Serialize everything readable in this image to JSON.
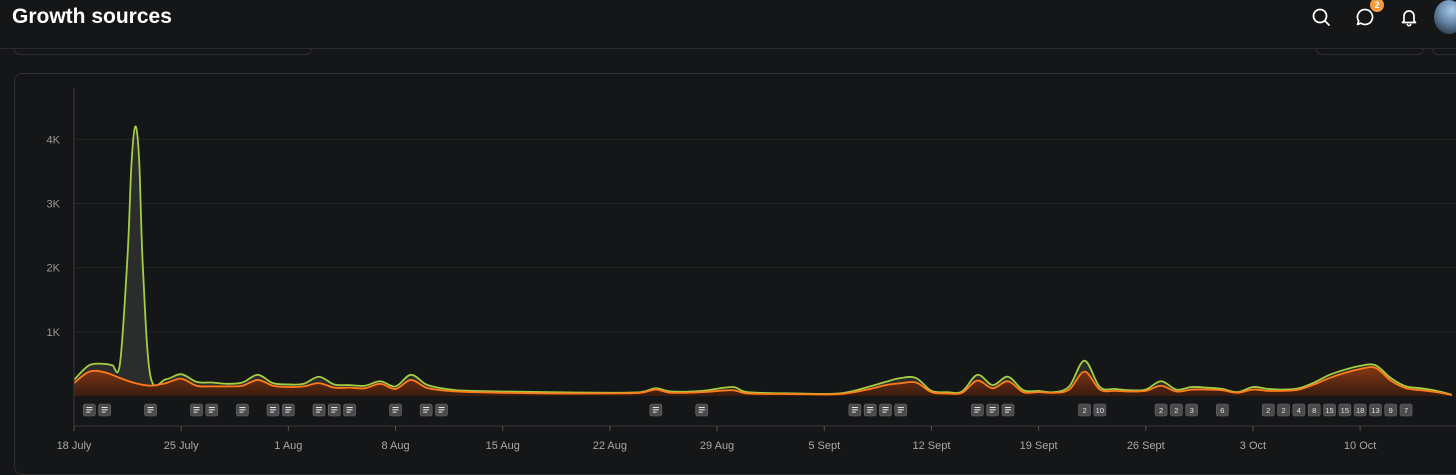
{
  "header": {
    "title": "Growth sources",
    "notification_count": "2",
    "icons": [
      "search-icon",
      "messages-icon",
      "bell-icon",
      "avatar"
    ]
  },
  "chart_data": {
    "type": "area",
    "y_ticks": [
      {
        "value": 1000,
        "label": "1K"
      },
      {
        "value": 2000,
        "label": "2K"
      },
      {
        "value": 3000,
        "label": "3K"
      },
      {
        "value": 4000,
        "label": "4K"
      }
    ],
    "ylim": [
      0,
      4800
    ],
    "x_start": "2023-07-18",
    "x_end": "2023-10-16",
    "x_ticks": [
      {
        "date": "2023-07-18",
        "label": "18 July"
      },
      {
        "date": "2023-07-25",
        "label": "25 July"
      },
      {
        "date": "2023-08-01",
        "label": "1 Aug"
      },
      {
        "date": "2023-08-08",
        "label": "8 Aug"
      },
      {
        "date": "2023-08-15",
        "label": "15 Aug"
      },
      {
        "date": "2023-08-22",
        "label": "22 Aug"
      },
      {
        "date": "2023-08-29",
        "label": "29 Aug"
      },
      {
        "date": "2023-09-05",
        "label": "5 Sept"
      },
      {
        "date": "2023-09-12",
        "label": "12 Sept"
      },
      {
        "date": "2023-09-19",
        "label": "19 Sept"
      },
      {
        "date": "2023-09-26",
        "label": "26 Sept"
      },
      {
        "date": "2023-10-03",
        "label": "3 Oct"
      },
      {
        "date": "2023-10-10",
        "label": "10 Oct"
      }
    ],
    "colors": {
      "total": "#9fcf3a",
      "orange": "#ff7a1a",
      "spike_outline": "#b8c86a"
    },
    "series": [
      {
        "key": "total",
        "points": [
          [
            "2023-07-18",
            250
          ],
          [
            "2023-07-19",
            480
          ],
          [
            "2023-07-20",
            500
          ],
          [
            "2023-07-20T12:00",
            480
          ],
          [
            "2023-07-21",
            500
          ],
          [
            "2023-07-21T12:00",
            2200
          ],
          [
            "2023-07-21T18:00",
            3600
          ],
          [
            "2023-07-22",
            4200
          ],
          [
            "2023-07-22T06:00",
            3700
          ],
          [
            "2023-07-22T12:00",
            2000
          ],
          [
            "2023-07-23",
            300
          ],
          [
            "2023-07-24",
            260
          ],
          [
            "2023-07-25",
            340
          ],
          [
            "2023-07-26",
            220
          ],
          [
            "2023-07-27",
            210
          ],
          [
            "2023-07-28",
            190
          ],
          [
            "2023-07-29",
            210
          ],
          [
            "2023-07-30",
            330
          ],
          [
            "2023-07-31",
            200
          ],
          [
            "2023-08-01",
            180
          ],
          [
            "2023-08-02",
            190
          ],
          [
            "2023-08-03",
            300
          ],
          [
            "2023-08-04",
            180
          ],
          [
            "2023-08-05",
            170
          ],
          [
            "2023-08-06",
            160
          ],
          [
            "2023-08-07",
            230
          ],
          [
            "2023-08-08",
            150
          ],
          [
            "2023-08-09",
            330
          ],
          [
            "2023-08-10",
            180
          ],
          [
            "2023-08-11",
            120
          ],
          [
            "2023-08-12",
            90
          ],
          [
            "2023-08-13",
            80
          ],
          [
            "2023-08-15",
            70
          ],
          [
            "2023-08-18",
            60
          ],
          [
            "2023-08-22",
            50
          ],
          [
            "2023-08-24",
            60
          ],
          [
            "2023-08-25",
            120
          ],
          [
            "2023-08-26",
            70
          ],
          [
            "2023-08-28",
            80
          ],
          [
            "2023-08-30",
            140
          ],
          [
            "2023-08-31",
            60
          ],
          [
            "2023-09-03",
            40
          ],
          [
            "2023-09-06",
            40
          ],
          [
            "2023-09-08",
            150
          ],
          [
            "2023-09-09",
            220
          ],
          [
            "2023-09-10",
            280
          ],
          [
            "2023-09-11",
            280
          ],
          [
            "2023-09-12",
            80
          ],
          [
            "2023-09-13",
            60
          ],
          [
            "2023-09-14",
            70
          ],
          [
            "2023-09-15",
            330
          ],
          [
            "2023-09-16",
            170
          ],
          [
            "2023-09-17",
            300
          ],
          [
            "2023-09-18",
            90
          ],
          [
            "2023-09-19",
            80
          ],
          [
            "2023-09-20",
            60
          ],
          [
            "2023-09-21",
            150
          ],
          [
            "2023-09-22",
            550
          ],
          [
            "2023-09-23",
            140
          ],
          [
            "2023-09-24",
            110
          ],
          [
            "2023-09-25",
            90
          ],
          [
            "2023-09-26",
            100
          ],
          [
            "2023-09-27",
            230
          ],
          [
            "2023-09-28",
            100
          ],
          [
            "2023-09-29",
            140
          ],
          [
            "2023-09-30",
            130
          ],
          [
            "2023-10-01",
            110
          ],
          [
            "2023-10-02",
            60
          ],
          [
            "2023-10-03",
            140
          ],
          [
            "2023-10-04",
            110
          ],
          [
            "2023-10-05",
            100
          ],
          [
            "2023-10-06",
            120
          ],
          [
            "2023-10-07",
            210
          ],
          [
            "2023-10-08",
            330
          ],
          [
            "2023-10-09",
            410
          ],
          [
            "2023-10-10",
            470
          ],
          [
            "2023-10-11",
            480
          ],
          [
            "2023-10-12",
            280
          ],
          [
            "2023-10-13",
            150
          ],
          [
            "2023-10-14",
            120
          ],
          [
            "2023-10-15",
            80
          ],
          [
            "2023-10-16",
            20
          ]
        ]
      },
      {
        "key": "orange",
        "points": [
          [
            "2023-07-18",
            200
          ],
          [
            "2023-07-19",
            380
          ],
          [
            "2023-07-20",
            370
          ],
          [
            "2023-07-21",
            280
          ],
          [
            "2023-07-22",
            200
          ],
          [
            "2023-07-23",
            160
          ],
          [
            "2023-07-24",
            200
          ],
          [
            "2023-07-25",
            270
          ],
          [
            "2023-07-26",
            160
          ],
          [
            "2023-07-27",
            150
          ],
          [
            "2023-07-28",
            150
          ],
          [
            "2023-07-29",
            160
          ],
          [
            "2023-07-30",
            250
          ],
          [
            "2023-07-31",
            160
          ],
          [
            "2023-08-01",
            140
          ],
          [
            "2023-08-02",
            150
          ],
          [
            "2023-08-03",
            200
          ],
          [
            "2023-08-04",
            130
          ],
          [
            "2023-08-05",
            130
          ],
          [
            "2023-08-06",
            120
          ],
          [
            "2023-08-07",
            190
          ],
          [
            "2023-08-08",
            110
          ],
          [
            "2023-08-09",
            250
          ],
          [
            "2023-08-10",
            130
          ],
          [
            "2023-08-11",
            90
          ],
          [
            "2023-08-12",
            70
          ],
          [
            "2023-08-13",
            60
          ],
          [
            "2023-08-15",
            50
          ],
          [
            "2023-08-18",
            40
          ],
          [
            "2023-08-22",
            40
          ],
          [
            "2023-08-24",
            50
          ],
          [
            "2023-08-25",
            100
          ],
          [
            "2023-08-26",
            50
          ],
          [
            "2023-08-28",
            60
          ],
          [
            "2023-08-30",
            90
          ],
          [
            "2023-08-31",
            40
          ],
          [
            "2023-09-03",
            30
          ],
          [
            "2023-09-06",
            30
          ],
          [
            "2023-09-08",
            110
          ],
          [
            "2023-09-09",
            170
          ],
          [
            "2023-09-10",
            200
          ],
          [
            "2023-09-11",
            210
          ],
          [
            "2023-09-12",
            60
          ],
          [
            "2023-09-13",
            40
          ],
          [
            "2023-09-14",
            50
          ],
          [
            "2023-09-15",
            240
          ],
          [
            "2023-09-16",
            120
          ],
          [
            "2023-09-17",
            230
          ],
          [
            "2023-09-18",
            60
          ],
          [
            "2023-09-19",
            60
          ],
          [
            "2023-09-20",
            50
          ],
          [
            "2023-09-21",
            100
          ],
          [
            "2023-09-22",
            380
          ],
          [
            "2023-09-23",
            100
          ],
          [
            "2023-09-24",
            80
          ],
          [
            "2023-09-25",
            70
          ],
          [
            "2023-09-26",
            80
          ],
          [
            "2023-09-27",
            160
          ],
          [
            "2023-09-28",
            70
          ],
          [
            "2023-09-29",
            100
          ],
          [
            "2023-09-30",
            100
          ],
          [
            "2023-10-01",
            90
          ],
          [
            "2023-10-02",
            50
          ],
          [
            "2023-10-03",
            100
          ],
          [
            "2023-10-04",
            80
          ],
          [
            "2023-10-05",
            80
          ],
          [
            "2023-10-06",
            100
          ],
          [
            "2023-10-07",
            180
          ],
          [
            "2023-10-08",
            280
          ],
          [
            "2023-10-09",
            360
          ],
          [
            "2023-10-10",
            420
          ],
          [
            "2023-10-11",
            440
          ],
          [
            "2023-10-12",
            240
          ],
          [
            "2023-10-13",
            120
          ],
          [
            "2023-10-14",
            90
          ],
          [
            "2023-10-15",
            60
          ],
          [
            "2023-10-16",
            15
          ]
        ]
      }
    ],
    "markers": [
      {
        "date": "2023-07-19",
        "label": ""
      },
      {
        "date": "2023-07-20",
        "label": ""
      },
      {
        "date": "2023-07-23",
        "label": ""
      },
      {
        "date": "2023-07-26",
        "label": ""
      },
      {
        "date": "2023-07-27",
        "label": ""
      },
      {
        "date": "2023-07-29",
        "label": ""
      },
      {
        "date": "2023-07-31",
        "label": ""
      },
      {
        "date": "2023-08-01",
        "label": ""
      },
      {
        "date": "2023-08-03",
        "label": ""
      },
      {
        "date": "2023-08-04",
        "label": ""
      },
      {
        "date": "2023-08-05",
        "label": ""
      },
      {
        "date": "2023-08-08",
        "label": ""
      },
      {
        "date": "2023-08-10",
        "label": ""
      },
      {
        "date": "2023-08-11",
        "label": ""
      },
      {
        "date": "2023-08-25",
        "label": ""
      },
      {
        "date": "2023-08-28",
        "label": ""
      },
      {
        "date": "2023-09-07",
        "label": ""
      },
      {
        "date": "2023-09-08",
        "label": ""
      },
      {
        "date": "2023-09-09",
        "label": ""
      },
      {
        "date": "2023-09-10",
        "label": ""
      },
      {
        "date": "2023-09-15",
        "label": ""
      },
      {
        "date": "2023-09-16",
        "label": ""
      },
      {
        "date": "2023-09-17",
        "label": ""
      },
      {
        "date": "2023-09-22",
        "label": "2"
      },
      {
        "date": "2023-09-23",
        "label": "10"
      },
      {
        "date": "2023-09-27",
        "label": "2"
      },
      {
        "date": "2023-09-28",
        "label": "2"
      },
      {
        "date": "2023-09-29",
        "label": "3"
      },
      {
        "date": "2023-10-01",
        "label": "6"
      },
      {
        "date": "2023-10-04",
        "label": "2"
      },
      {
        "date": "2023-10-05",
        "label": "2"
      },
      {
        "date": "2023-10-06",
        "label": "4"
      },
      {
        "date": "2023-10-07",
        "label": "8"
      },
      {
        "date": "2023-10-08",
        "label": "15"
      },
      {
        "date": "2023-10-09",
        "label": "15"
      },
      {
        "date": "2023-10-10",
        "label": "18"
      },
      {
        "date": "2023-10-11",
        "label": "13"
      },
      {
        "date": "2023-10-12",
        "label": "9"
      },
      {
        "date": "2023-10-13",
        "label": "7"
      }
    ],
    "grid": true
  }
}
